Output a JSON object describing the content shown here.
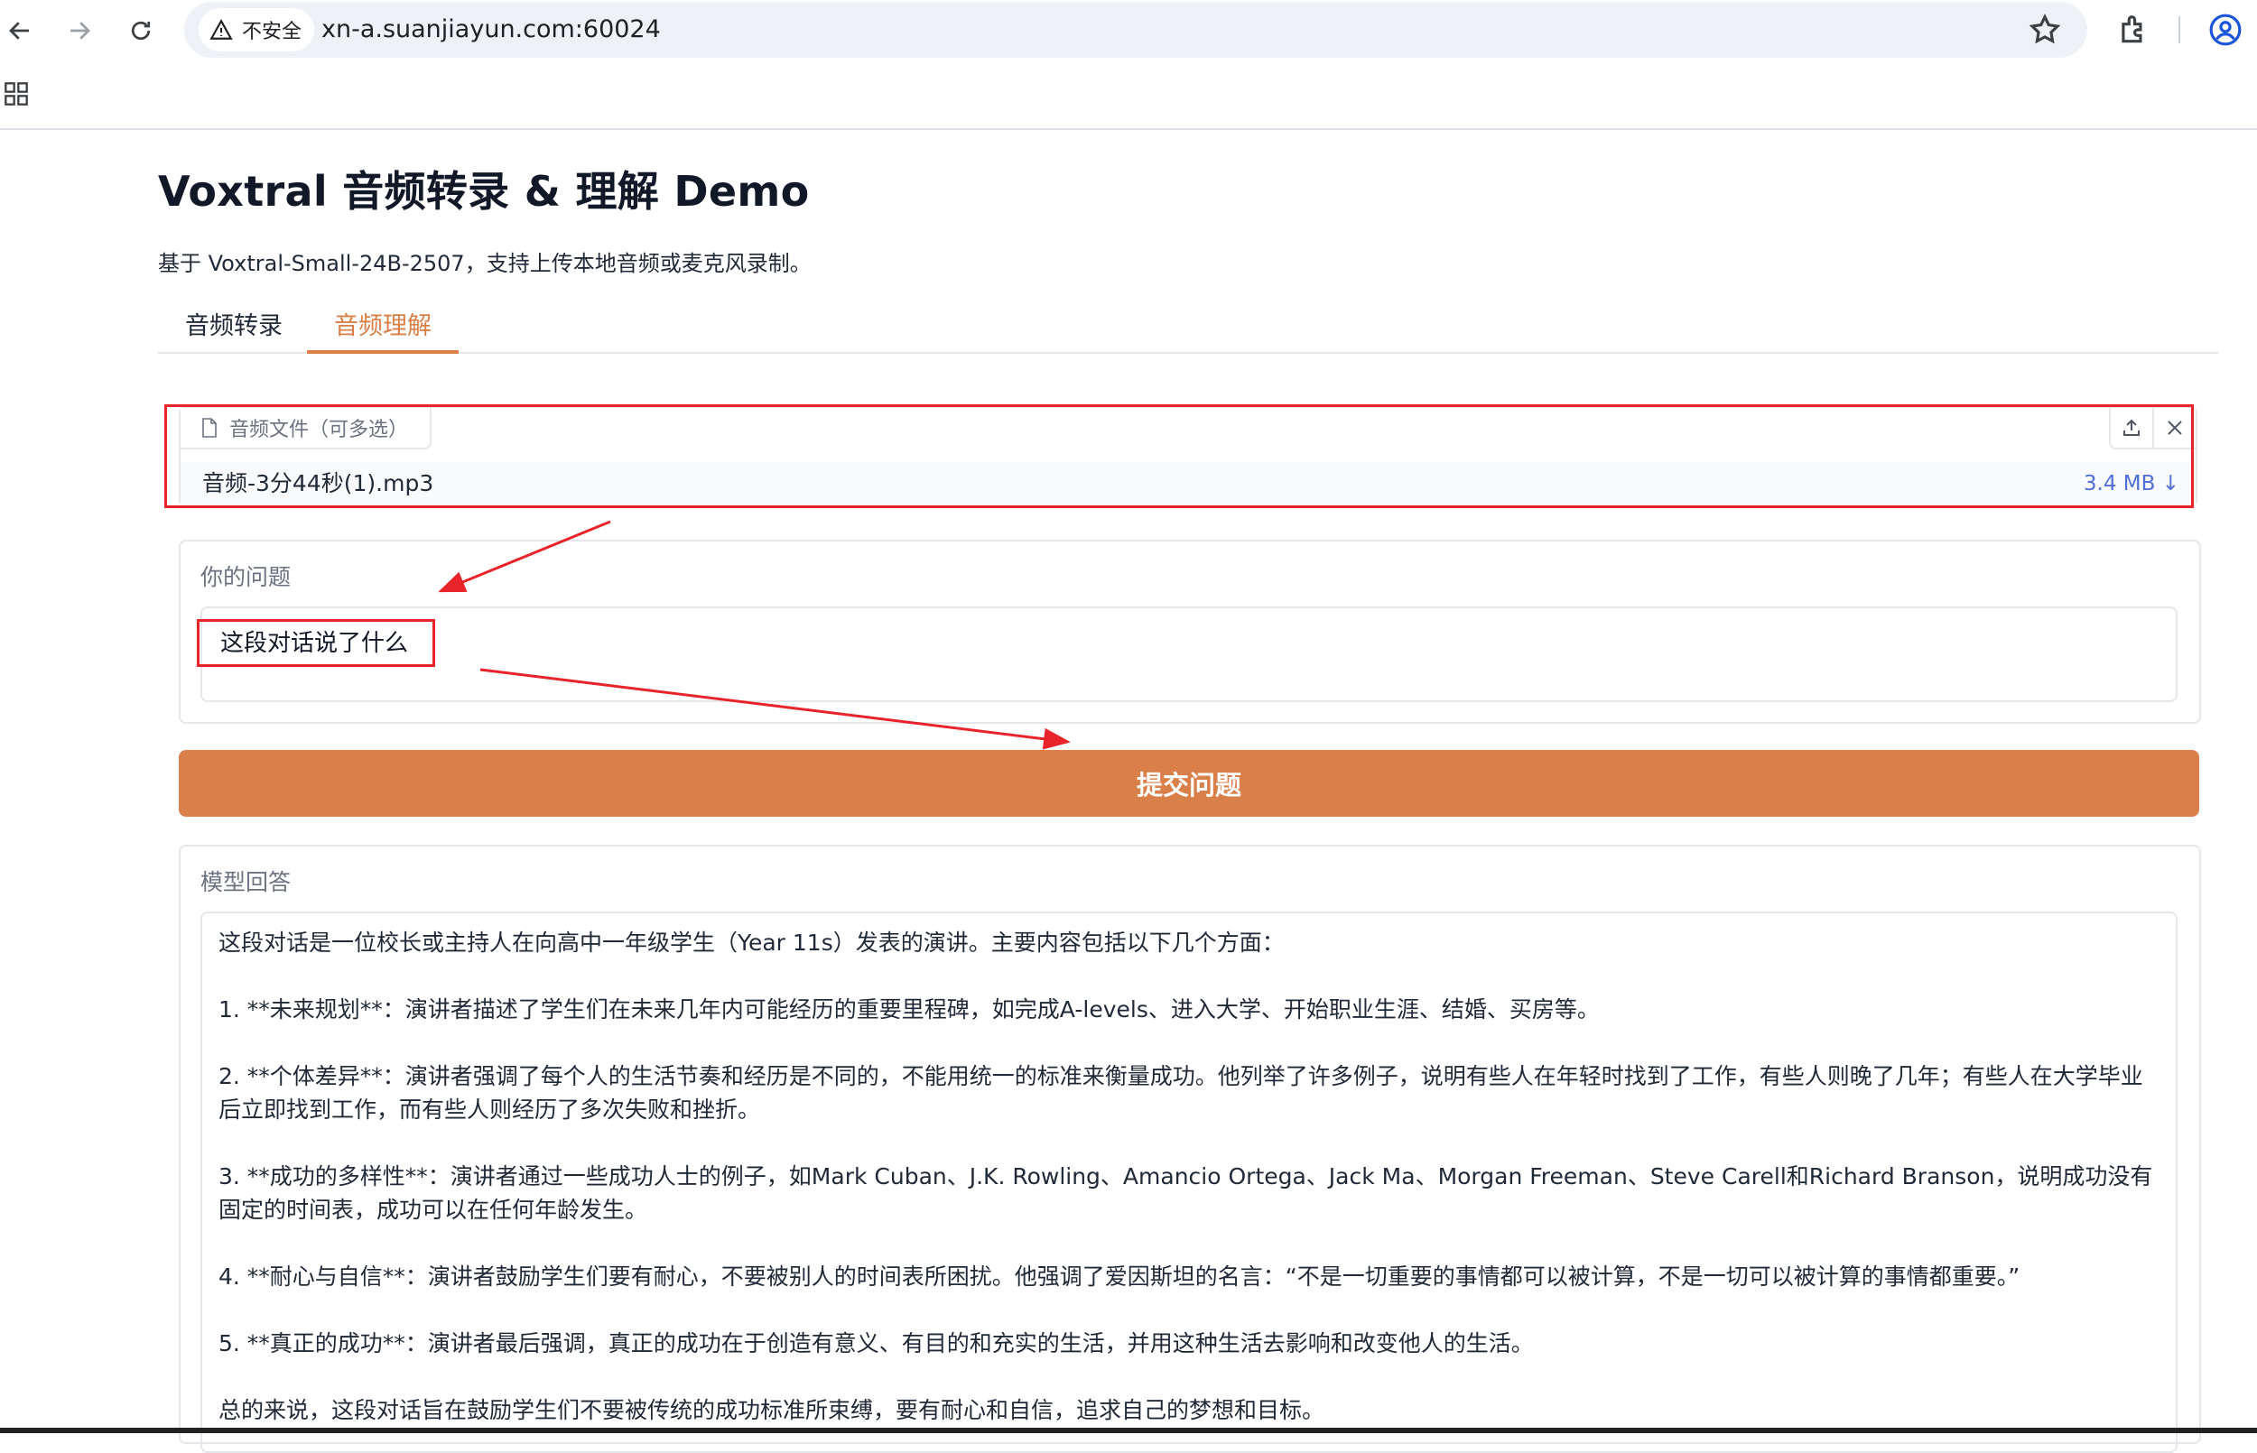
{
  "browser": {
    "security_label": "不安全",
    "url": "xn-a.suanjiayun.com:60024"
  },
  "page": {
    "title": "Voxtral 音频转录 & 理解 Demo",
    "subtitle": "基于 Voxtral-Small-24B-2507，支持上传本地音频或麦克风录制。"
  },
  "tabs": [
    {
      "label": "音频转录",
      "active": false
    },
    {
      "label": "音频理解",
      "active": true
    }
  ],
  "file_upload": {
    "label": "音频文件（可多选）",
    "file_name": "音频-3分44秒(1).mp3",
    "file_size": "3.4 MB ↓"
  },
  "question": {
    "label": "你的问题",
    "value": "这段对话说了什么"
  },
  "submit": {
    "label": "提交问题",
    "color": "#d9804a"
  },
  "answer": {
    "label": "模型回答",
    "paragraphs": [
      "这段对话是一位校长或主持人在向高中一年级学生（Year 11s）发表的演讲。主要内容包括以下几个方面：",
      "1. **未来规划**：演讲者描述了学生们在未来几年内可能经历的重要里程碑，如完成A-levels、进入大学、开始职业生涯、结婚、买房等。",
      "2. **个体差异**：演讲者强调了每个人的生活节奏和经历是不同的，不能用统一的标准来衡量成功。他列举了许多例子，说明有些人在年轻时找到了工作，有些人则晚了几年；有些人在大学毕业后立即找到工作，而有些人则经历了多次失败和挫折。",
      "3. **成功的多样性**：演讲者通过一些成功人士的例子，如Mark Cuban、J.K. Rowling、Amancio Ortega、Jack Ma、Morgan Freeman、Steve Carell和Richard Branson，说明成功没有固定的时间表，成功可以在任何年龄发生。",
      "4. **耐心与自信**：演讲者鼓励学生们要有耐心，不要被别人的时间表所困扰。他强调了爱因斯坦的名言：“不是一切重要的事情都可以被计算，不是一切可以被计算的事情都重要。”",
      "5. **真正的成功**：演讲者最后强调，真正的成功在于创造有意义、有目的和充实的生活，并用这种生活去影响和改变他人的生活。",
      "总的来说，这段对话旨在鼓励学生们不要被传统的成功标准所束缚，要有耐心和自信，追求自己的梦想和目标。"
    ]
  },
  "colors": {
    "accent": "#d97f45",
    "annotation": "#e8232a",
    "file_size": "#4f6fd8"
  }
}
